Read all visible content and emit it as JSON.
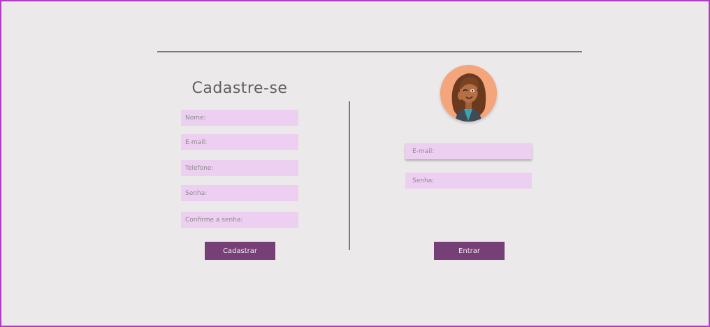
{
  "register": {
    "title": "Cadastre-se",
    "fields": {
      "name": {
        "placeholder": "Nome:"
      },
      "email": {
        "placeholder": "E-mail:"
      },
      "phone": {
        "placeholder": "Telefone:"
      },
      "password": {
        "placeholder": "Senha:"
      },
      "confirm_password": {
        "placeholder": "Confirme a senha:"
      }
    },
    "submit_label": "Cadastrar"
  },
  "login": {
    "avatar_icon": "woman-cartoon-avatar",
    "fields": {
      "email": {
        "placeholder": "E-mail:"
      },
      "password": {
        "placeholder": "Senha:"
      }
    },
    "submit_label": "Entrar"
  },
  "colors": {
    "background": "#ece9ea",
    "frame_border": "#b03cc4",
    "input_fill": "#eccff1",
    "button_fill": "#763f76",
    "avatar_bg": "#f4a57c"
  }
}
